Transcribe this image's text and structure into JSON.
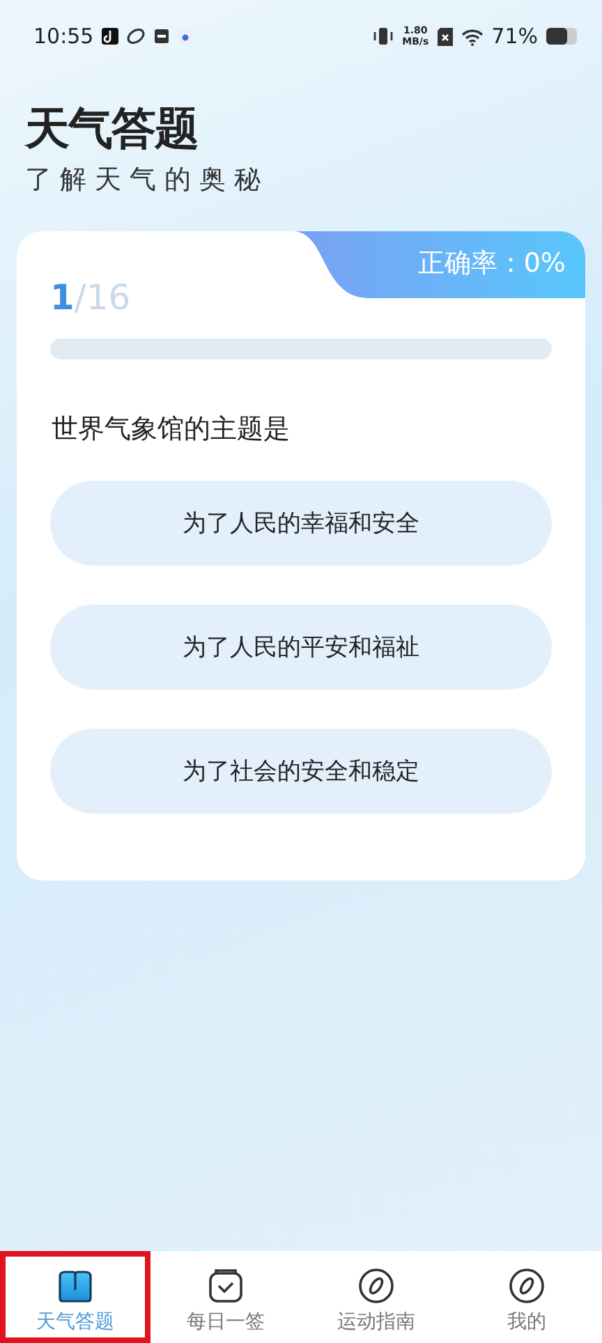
{
  "status_bar": {
    "time": "10:55",
    "speed_value": "1.80",
    "speed_unit": "MB/s",
    "battery": "71%"
  },
  "header": {
    "title": "天气答题",
    "subtitle": "了 解 天 气 的 奥 秘"
  },
  "quiz": {
    "current": "1",
    "total": "/16",
    "accuracy": "正确率：0%",
    "progress": {
      "level": 0
    },
    "question": "世界气象馆的主题是",
    "options": [
      {
        "label": "为了人民的幸福和安全",
        "selected": false
      },
      {
        "label": "为了人民的平安和福祉",
        "selected": false
      },
      {
        "label": "为了社会的安全和稳定",
        "selected": false
      }
    ]
  },
  "tab_bar": [
    {
      "label": "天气答题",
      "kind": "book",
      "selected": true,
      "outlined": true
    },
    {
      "label": "每日一签",
      "kind": "bag",
      "selected": false,
      "outlined": false
    },
    {
      "label": "运动指南",
      "kind": "compass",
      "selected": false,
      "outlined": false
    },
    {
      "label": "我的",
      "kind": "compass",
      "selected": false,
      "outlined": false
    }
  ]
}
